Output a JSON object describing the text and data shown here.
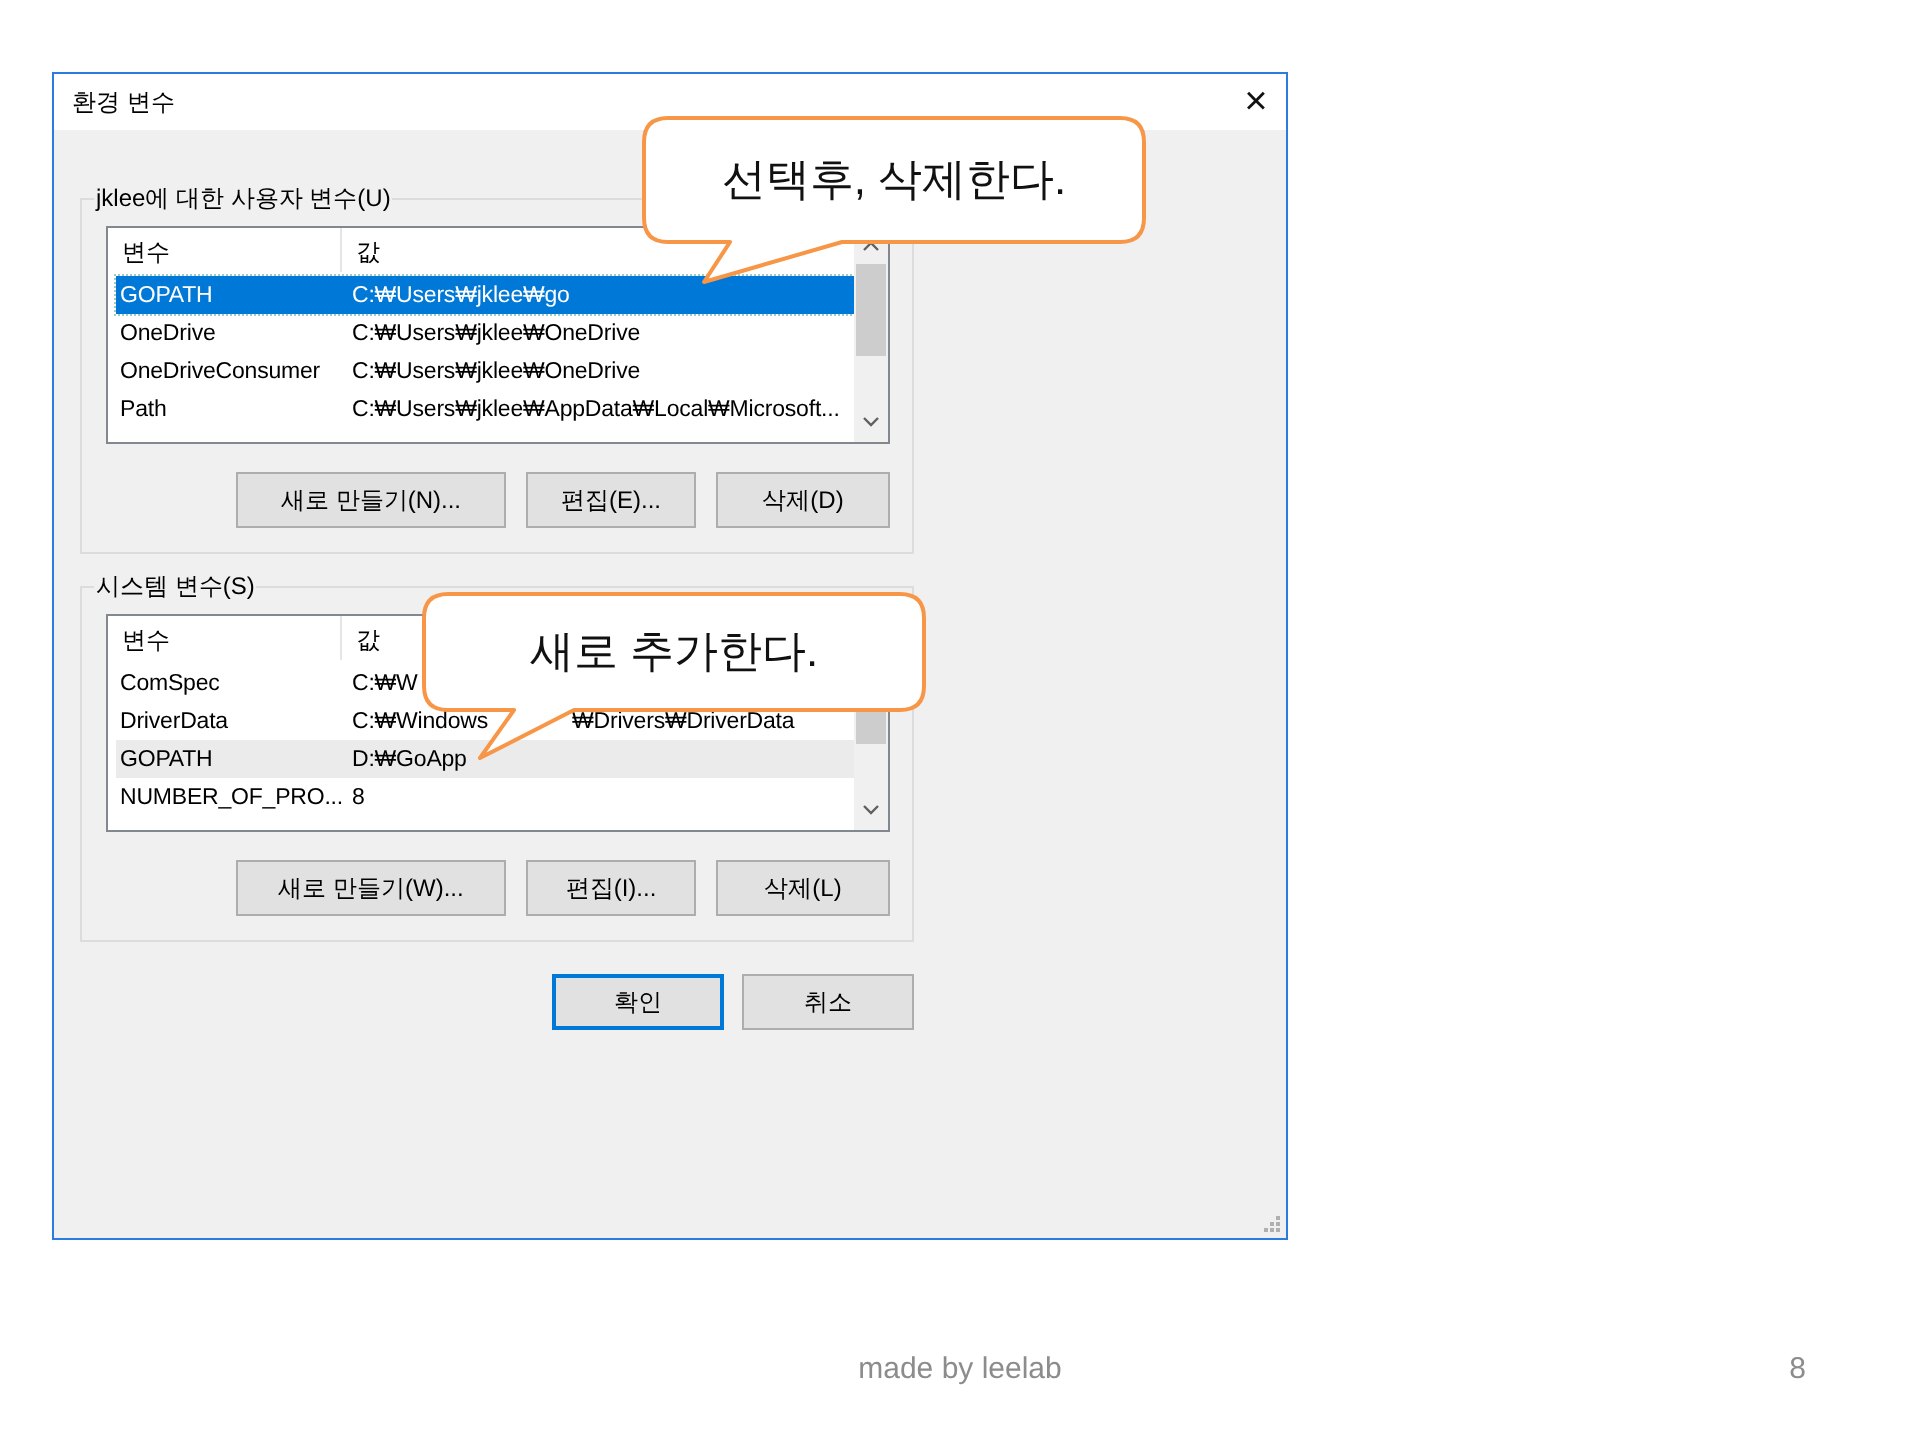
{
  "window": {
    "title": "환경 변수",
    "close": "×"
  },
  "groups": [
    {
      "label": "jklee에 대한 사용자 변수(U)",
      "focused": true,
      "columns": [
        "변수",
        "값"
      ],
      "rows": [
        {
          "name": "GOPATH",
          "value": "C:₩Users₩jklee₩go",
          "selected": true
        },
        {
          "name": "OneDrive",
          "value": "C:₩Users₩jklee₩OneDrive",
          "selected": false
        },
        {
          "name": "OneDriveConsumer",
          "value": "C:₩Users₩jklee₩OneDrive",
          "selected": false
        },
        {
          "name": "Path",
          "value": "C:₩Users₩jklee₩AppData₩Local₩Microsoft...",
          "selected": false
        }
      ],
      "buttons": [
        "새로 만들기(N)...",
        "편집(E)...",
        "삭제(D)"
      ]
    },
    {
      "label": "시스템 변수(S)",
      "focused": false,
      "columns": [
        "변수",
        "값"
      ],
      "rows": [
        {
          "name": "ComSpec",
          "value": "C:₩W",
          "selected": false
        },
        {
          "name": "DriverData",
          "value": "C:₩Windows",
          "value_end": "₩Drivers₩DriverData",
          "selected": false
        },
        {
          "name": "GOPATH",
          "value": "D:₩GoApp",
          "selected": true
        },
        {
          "name": "NUMBER_OF_PRO...",
          "value": "8",
          "selected": false
        }
      ],
      "buttons": [
        "새로 만들기(W)...",
        "편집(I)...",
        "삭제(L)"
      ]
    }
  ],
  "dialog_buttons": [
    {
      "label": "확인",
      "default": true
    },
    {
      "label": "취소",
      "default": false
    }
  ],
  "callouts": [
    {
      "text": "선택후, 삭제한다."
    },
    {
      "text": "새로 추가한다."
    }
  ],
  "footer": {
    "credit": "made by leelab",
    "page": "8"
  }
}
